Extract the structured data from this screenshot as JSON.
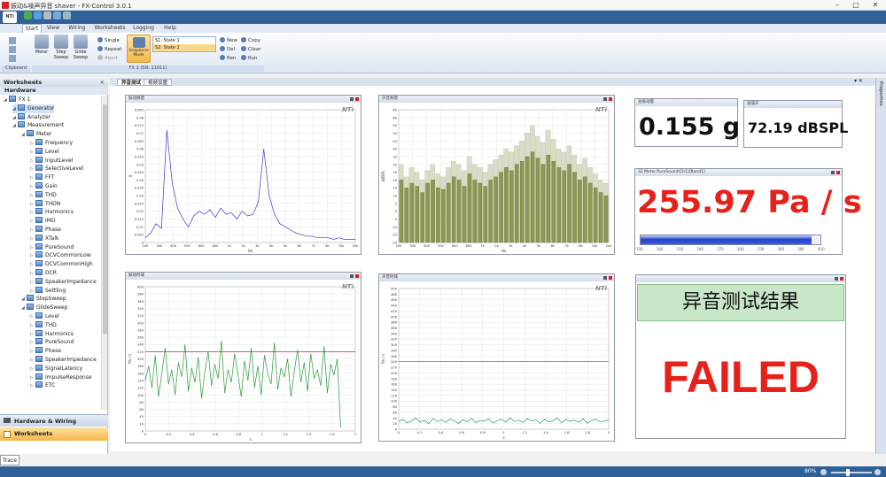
{
  "window": {
    "title": "振动&噪声异音 shaver - FX-Control 3.0.1"
  },
  "ribbon": {
    "tabs": [
      "Start",
      "View",
      "Wiring",
      "Worksheets",
      "Logging",
      "Help"
    ],
    "groups": {
      "clipboard": "Clipboard",
      "device": "FX 1 (SN: 11011)"
    },
    "buttons": {
      "meter": "Meter",
      "step_sweep": "Step Sweep",
      "glide_sweep": "Glide Sweep",
      "sequence_mode": "Sequence Mode"
    },
    "small": {
      "single": "Single",
      "repeat": "Repeat",
      "abort": "Abort",
      "new": "New",
      "del": "Del",
      "ren": "Ren",
      "copy": "Copy",
      "clear": "Clear",
      "run": "Run"
    },
    "states": [
      "S1: State 1",
      "S2: State 2"
    ]
  },
  "sidebar": {
    "header": "Worksheets",
    "subheader": "Hardware",
    "tree": [
      {
        "label": "FX 1",
        "level": 0
      },
      {
        "label": "Generator",
        "level": 1
      },
      {
        "label": "Analyzer",
        "level": 1
      },
      {
        "label": "Measurement",
        "level": 1
      },
      {
        "label": "Meter",
        "level": 2
      },
      {
        "label": "Frequency",
        "level": 3
      },
      {
        "label": "Level",
        "level": 3
      },
      {
        "label": "InputLevel",
        "level": 3
      },
      {
        "label": "SelectiveLevel",
        "level": 3
      },
      {
        "label": "FFT",
        "level": 3
      },
      {
        "label": "Gain",
        "level": 3
      },
      {
        "label": "THD",
        "level": 3
      },
      {
        "label": "THDN",
        "level": 3
      },
      {
        "label": "Harmonics",
        "level": 3
      },
      {
        "label": "IMD",
        "level": 3
      },
      {
        "label": "Phase",
        "level": 3
      },
      {
        "label": "XTalk",
        "level": 3
      },
      {
        "label": "PureSound",
        "level": 3
      },
      {
        "label": "DCVCommonLow",
        "level": 3
      },
      {
        "label": "DCVCommonHigh",
        "level": 3
      },
      {
        "label": "DCR",
        "level": 3
      },
      {
        "label": "SpeakerImpedance",
        "level": 3
      },
      {
        "label": "Settling",
        "level": 3
      },
      {
        "label": "StepSweep",
        "level": 2
      },
      {
        "label": "GlideSweep",
        "level": 2
      },
      {
        "label": "Level",
        "level": 3
      },
      {
        "label": "THD",
        "level": 3
      },
      {
        "label": "Harmonics",
        "level": 3
      },
      {
        "label": "PureSound",
        "level": 3
      },
      {
        "label": "Phase",
        "level": 3
      },
      {
        "label": "SpeakerImpedance",
        "level": 3
      },
      {
        "label": "SignalLatency",
        "level": 3
      },
      {
        "label": "ImpulseResponse",
        "level": 3
      },
      {
        "label": "ETC",
        "level": 3
      }
    ],
    "nav": {
      "hardware": "Hardware & Wiring",
      "worksheets": "Worksheets"
    }
  },
  "trace": "Trace",
  "properties": "Properties",
  "doc_tabs": [
    "异音测试",
    "视频设置"
  ],
  "status": {
    "zoom": "80%"
  },
  "panels": {
    "vib_spec": {
      "title": "振动频谱",
      "logo": "NTi"
    },
    "noise_spec": {
      "title": "声音频谱",
      "logo": "NTi"
    },
    "vib_time": {
      "title": "振动时域",
      "logo": "NTi"
    },
    "noise_time": {
      "title": "声音时域",
      "logo": "NTi"
    },
    "vib_level": {
      "title": "总振动量",
      "value": "0.155 g"
    },
    "noise_level": {
      "title": "总噪声",
      "value": "72.19 dBSPL"
    },
    "puresound": {
      "title": "S2 Meter.PureSound(Ch1)[Band1]",
      "value": "255.97 Pa / s",
      "bar_fraction": 0.95,
      "bar_ticks": [
        "150",
        "180",
        "210",
        "240",
        "270",
        "300",
        "330",
        "360",
        "390",
        "420"
      ]
    },
    "result": {
      "title": "异音测试结果",
      "status": "FAILED"
    }
  },
  "colors": {
    "accent": "#2f6098",
    "failed": "#e8201a",
    "green": "#c8e6c8"
  },
  "chart_data": [
    {
      "type": "line",
      "panel": "振动频谱",
      "xscale": "log",
      "xlabel": "Hz",
      "ylabel": "g",
      "xticks": [
        "200",
        "300",
        "400",
        "500",
        "600",
        "800",
        "1k",
        "2k",
        "3k",
        "4k",
        "5k",
        "6k",
        "7k",
        "8k",
        "10k",
        "20k"
      ],
      "yticks": [
        "0",
        "0.005",
        "0.01",
        "0.015",
        "0.02",
        "0.025",
        "0.03",
        "0.035",
        "0.04",
        "0.045",
        "0.05",
        "0.055",
        "0.06",
        "0.065",
        "0.07",
        "0.075",
        "0.08",
        "0.085"
      ],
      "ylim": [
        0,
        0.085
      ],
      "series": [
        {
          "values": [
            0.003,
            0.006,
            0.012,
            0.009,
            0.072,
            0.038,
            0.022,
            0.015,
            0.01,
            0.017,
            0.02,
            0.018,
            0.021,
            0.016,
            0.022,
            0.018,
            0.019,
            0.015,
            0.02,
            0.017,
            0.018,
            0.026,
            0.06,
            0.03,
            0.018,
            0.012,
            0.01,
            0.008,
            0.006,
            0.005,
            0.004,
            0.004,
            0.003,
            0.003,
            0.003,
            0.002,
            0.003,
            0.002,
            0.002,
            0.002
          ]
        }
      ]
    },
    {
      "type": "bar",
      "panel": "声音频谱",
      "xscale": "log",
      "xlabel": "Hz",
      "ylabel": "dBSPL",
      "xticks": [
        "200",
        "300",
        "400",
        "500",
        "600",
        "800",
        "1k",
        "2k",
        "3k",
        "4k",
        "5k",
        "6k",
        "7k",
        "8k",
        "10k",
        "20k"
      ],
      "yticks": [
        "-20",
        "-15",
        "-10",
        "-5",
        "0",
        "5",
        "10",
        "15",
        "20",
        "25",
        "30",
        "35",
        "40",
        "45",
        "50",
        "55",
        "60",
        "65"
      ],
      "ylim": [
        -20,
        65
      ],
      "series": [
        {
          "values": [
            30,
            22,
            28,
            25,
            20,
            26,
            30,
            24,
            22,
            28,
            32,
            30,
            26,
            35,
            30,
            28,
            25,
            30,
            33,
            36,
            40,
            38,
            42,
            45,
            50,
            55,
            48,
            44,
            52,
            46,
            40,
            38,
            42,
            36,
            30,
            34,
            28,
            24,
            20,
            18
          ]
        },
        {
          "values": [
            20,
            15,
            18,
            16,
            12,
            18,
            20,
            15,
            14,
            18,
            22,
            20,
            16,
            24,
            20,
            18,
            16,
            20,
            22,
            25,
            28,
            26,
            30,
            32,
            35,
            38,
            34,
            30,
            36,
            32,
            28,
            26,
            30,
            25,
            20,
            22,
            18,
            15,
            12,
            10
          ]
        }
      ]
    },
    {
      "type": "line",
      "panel": "振动时域",
      "xlabel": "s",
      "ylabel": "Pa / s",
      "xticks": [
        "0",
        "0.2",
        "0.4",
        "0.6",
        "0.8",
        "1",
        "1.2",
        "1.4",
        "1.6",
        "2"
      ],
      "yticks": [
        "0",
        "20",
        "40",
        "60",
        "80",
        "100",
        "120",
        "140",
        "160",
        "180",
        "200",
        "220",
        "240",
        "260",
        "280",
        "300",
        "320",
        "340",
        "360",
        "380",
        "400"
      ],
      "ylim": [
        0,
        400
      ],
      "threshold": 220,
      "series": [
        {
          "values": [
            140,
            180,
            120,
            210,
            95,
            160,
            230,
            130,
            170,
            100,
            190,
            150,
            240,
            110,
            175,
            135,
            205,
            90,
            165,
            220,
            125,
            185,
            145,
            250,
            105,
            170,
            135,
            215,
            155,
            95,
            195,
            140,
            230,
            120,
            180,
            100,
            210,
            160,
            130,
            245,
            115,
            175,
            150,
            200,
            95,
            165,
            225,
            135,
            190,
            110,
            215,
            145,
            170,
            125,
            235,
            105,
            185,
            155,
            200,
            10
          ]
        }
      ]
    },
    {
      "type": "line",
      "panel": "声音时域",
      "xlabel": "s",
      "ylabel": "Pa / s",
      "xticks": [
        "0",
        "0.2",
        "0.4",
        "0.6",
        "0.8",
        "1",
        "1.2",
        "1.4",
        "1.6",
        "1.8",
        "2"
      ],
      "yticks": [
        "0",
        "20",
        "40",
        "60",
        "80",
        "100",
        "120",
        "140",
        "160",
        "180",
        "200",
        "220",
        "240",
        "260",
        "280",
        "300",
        "320",
        "340",
        "360",
        "380",
        "400",
        "420",
        "440",
        "460",
        "480",
        "500"
      ],
      "ylim": [
        0,
        500
      ],
      "threshold": 240,
      "series": [
        {
          "values": [
            28,
            35,
            22,
            30,
            40,
            25,
            32,
            20,
            38,
            27,
            33,
            24,
            36,
            29,
            21,
            34,
            26,
            39,
            23,
            31,
            28,
            37,
            22,
            30,
            35,
            25,
            41,
            27,
            32,
            24,
            38,
            29,
            33,
            21,
            36,
            26,
            30,
            40,
            23,
            34,
            28,
            32,
            25,
            37,
            22,
            31,
            35,
            27,
            29,
            33
          ]
        }
      ]
    }
  ]
}
